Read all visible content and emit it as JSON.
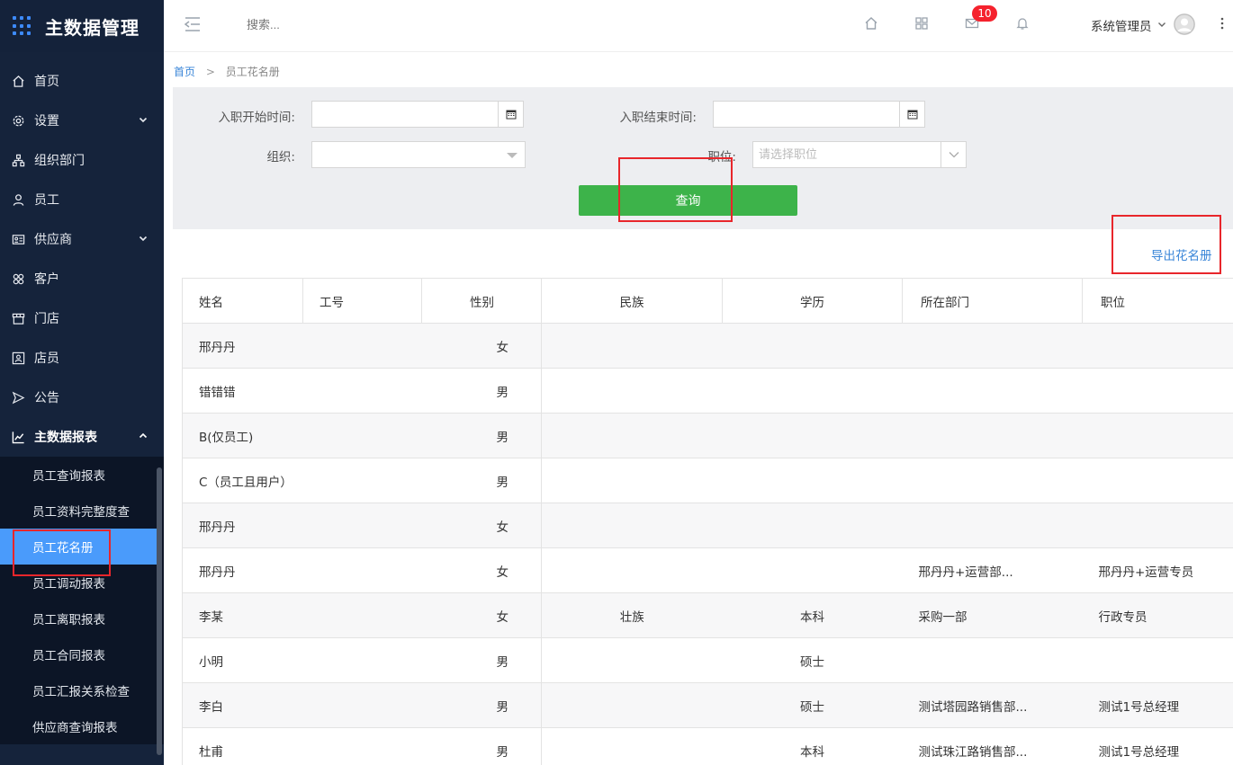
{
  "app": {
    "title": "主数据管理"
  },
  "sidebar": {
    "items": [
      {
        "label": "首页",
        "icon": "home-icon"
      },
      {
        "label": "设置",
        "icon": "gear-icon",
        "expandable": true
      },
      {
        "label": "组织部门",
        "icon": "org-tree-icon"
      },
      {
        "label": "员工",
        "icon": "user-icon"
      },
      {
        "label": "供应商",
        "icon": "id-card-icon",
        "expandable": true
      },
      {
        "label": "客户",
        "icon": "customers-icon"
      },
      {
        "label": "门店",
        "icon": "store-icon"
      },
      {
        "label": "店员",
        "icon": "clerk-icon"
      },
      {
        "label": "公告",
        "icon": "announcement-icon"
      },
      {
        "label": "主数据报表",
        "icon": "chart-icon",
        "expanded": true
      }
    ],
    "subitems": [
      {
        "label": "员工查询报表"
      },
      {
        "label": "员工资料完整度查"
      },
      {
        "label": "员工花名册",
        "selected": true
      },
      {
        "label": "员工调动报表"
      },
      {
        "label": "员工离职报表"
      },
      {
        "label": "员工合同报表"
      },
      {
        "label": "员工汇报关系检查"
      },
      {
        "label": "供应商查询报表"
      }
    ]
  },
  "topbar": {
    "search_placeholder": "搜索...",
    "message_badge": "10",
    "user_name": "系统管理员"
  },
  "breadcrumb": {
    "home": "首页",
    "separator": ">",
    "current": "员工花名册"
  },
  "filter": {
    "start_label": "入职开始时间:",
    "end_label": "入职结束时间:",
    "org_label": "组织:",
    "position_label": "职位:",
    "position_placeholder": "请选择职位",
    "start_value": "",
    "end_value": "",
    "org_value": "",
    "query_label": "查询"
  },
  "export_label": "导出花名册",
  "table": {
    "columns": [
      "姓名",
      "工号",
      "性别",
      "民族",
      "学历",
      "所在部门",
      "职位"
    ],
    "rows": [
      {
        "name": "邢丹丹",
        "id": "",
        "sex": "女",
        "ethnicity": "",
        "education": "",
        "dept": "",
        "position": ""
      },
      {
        "name": "错错错",
        "id": "",
        "sex": "男",
        "ethnicity": "",
        "education": "",
        "dept": "",
        "position": ""
      },
      {
        "name": "B(仅员工)",
        "id": "",
        "sex": "男",
        "ethnicity": "",
        "education": "",
        "dept": "",
        "position": ""
      },
      {
        "name": "C（员工且用户）",
        "id": "",
        "sex": "男",
        "ethnicity": "",
        "education": "",
        "dept": "",
        "position": ""
      },
      {
        "name": "邢丹丹",
        "id": "",
        "sex": "女",
        "ethnicity": "",
        "education": "",
        "dept": "",
        "position": ""
      },
      {
        "name": "邢丹丹",
        "id": "",
        "sex": "女",
        "ethnicity": "",
        "education": "",
        "dept": "邢丹丹+运营部...",
        "position": "邢丹丹+运营专员"
      },
      {
        "name": "李某",
        "id": "",
        "sex": "女",
        "ethnicity": "壮族",
        "education": "本科",
        "dept": "采购一部",
        "position": "行政专员"
      },
      {
        "name": "小明",
        "id": "",
        "sex": "男",
        "ethnicity": "",
        "education": "硕士",
        "dept": "",
        "position": ""
      },
      {
        "name": "李白",
        "id": "",
        "sex": "男",
        "ethnicity": "",
        "education": "硕士",
        "dept": "测试塔园路销售部...",
        "position": "测试1号总经理"
      },
      {
        "name": "杜甫",
        "id": "",
        "sex": "男",
        "ethnicity": "",
        "education": "本科",
        "dept": "测试珠江路销售部...",
        "position": "测试1号总经理"
      }
    ]
  },
  "colors": {
    "sidebar_bg": "#15233b",
    "accent": "#4a9bfb",
    "query_button": "#3db34a",
    "highlight": "#e8262b",
    "link": "#3a86d8"
  }
}
